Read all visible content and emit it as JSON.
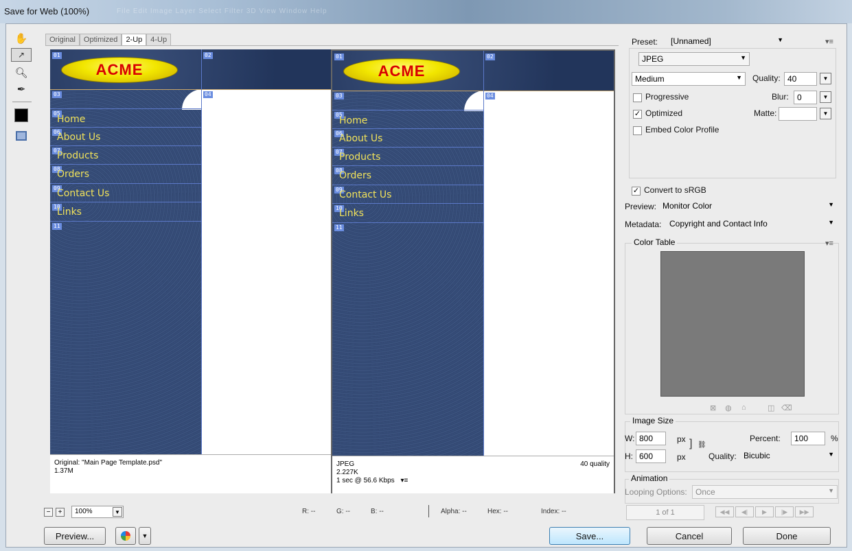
{
  "window": {
    "title": "Save for Web (100%)",
    "ghost_menu": "File   Edit   Image   Layer   Select   Filter   3D   View   Window   Help"
  },
  "tabs": [
    "Original",
    "Optimized",
    "2-Up",
    "4-Up"
  ],
  "art": {
    "logo_text": "ACME",
    "nav": [
      "Home",
      "About Us",
      "Products",
      "Orders",
      "Contact Us",
      "Links"
    ],
    "slice_tags": {
      "s01": "01",
      "s02": "02",
      "s03": "03",
      "s04": "04",
      "s05": "05",
      "s06": "06",
      "s07": "07",
      "s08": "08",
      "s09": "09",
      "s10": "10",
      "s11": "11"
    }
  },
  "left_info": {
    "line1": "Original: \"Main Page Template.psd\"",
    "line2": "1.37M"
  },
  "right_info": {
    "line1": "JPEG",
    "line2": "2.227K",
    "line3": "1 sec @ 56.6 Kbps",
    "menu": "▾≡",
    "quality": "40 quality"
  },
  "zoom": {
    "minus": "−",
    "plus": "+",
    "value": "100%"
  },
  "readouts": {
    "r": "R: --",
    "g": "G: --",
    "b": "B: --",
    "alpha": "Alpha: --",
    "hex": "Hex: --",
    "index": "Index: --"
  },
  "buttons": {
    "preview": "Preview...",
    "save": "Save...",
    "cancel": "Cancel",
    "done": "Done"
  },
  "panel": {
    "preset_label": "Preset:",
    "preset_value": "[Unnamed]",
    "format": "JPEG",
    "quality_level": "Medium",
    "quality_label": "Quality:",
    "quality_value": "40",
    "progressive": "Progressive",
    "blur_label": "Blur:",
    "blur_value": "0",
    "optimized": "Optimized",
    "matte_label": "Matte:",
    "embed": "Embed Color Profile",
    "convert": "Convert to sRGB",
    "preview_label": "Preview:",
    "preview_value": "Monitor Color",
    "metadata_label": "Metadata:",
    "metadata_value": "Copyright and Contact Info",
    "color_table": "Color Table",
    "image_size": "Image Size",
    "w_label": "W:",
    "w_value": "800",
    "h_label": "H:",
    "h_value": "600",
    "px": "px",
    "percent_label": "Percent:",
    "percent_value": "100",
    "percent_sign": "%",
    "resample_label": "Quality:",
    "resample_value": "Bicubic",
    "animation": "Animation",
    "looping_label": "Looping Options:",
    "looping_value": "Once",
    "frame": "1 of 1"
  }
}
